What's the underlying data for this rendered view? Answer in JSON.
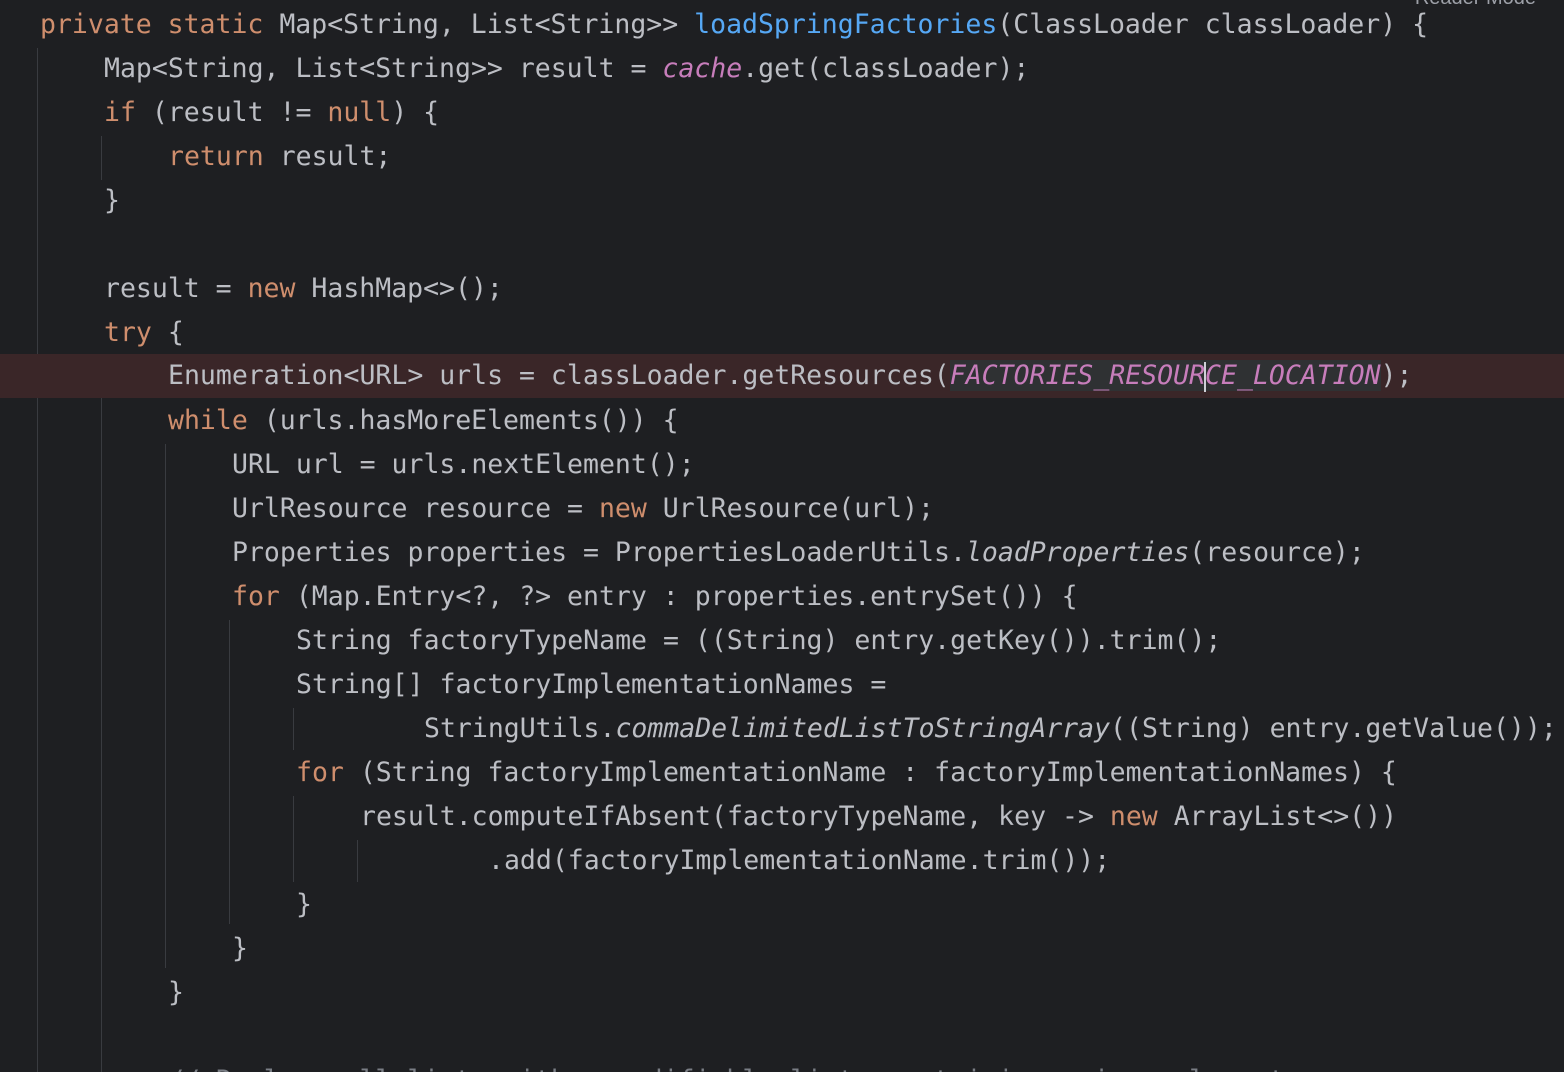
{
  "editor": {
    "reader_mode_label": "Reader Mode",
    "colors": {
      "background": "#1e1f22",
      "keyword": "#cf8e6d",
      "method_declaration": "#56a8f5",
      "static_field": "#c77dbb",
      "default_text": "#bcbec4",
      "current_line": "#3a2628"
    },
    "lines": {
      "l1": {
        "kw": "private static",
        "pre": " Map<String, List<String>> ",
        "fn": "loadSpringFactories",
        "post": "(ClassLoader classLoader) {"
      },
      "l2": {
        "pre": "Map<String, List<String>> result = ",
        "field": "cache",
        "post": ".get(classLoader);"
      },
      "l3": {
        "kw1": "if",
        "mid": " (result != ",
        "kw2": "null",
        "post": ") {"
      },
      "l4": {
        "kw": "return",
        "post": " result;"
      },
      "l5": {
        "text": "}"
      },
      "l6": {
        "pre": "result = ",
        "kw": "new",
        "post": " HashMap<>();"
      },
      "l7": {
        "kw": "try",
        "post": " {"
      },
      "l8": {
        "pre": "Enumeration<URL> urls = classLoader.getResources(",
        "const_a": "FACTORIES_RESOUR",
        "const_b": "CE_LOCATION",
        "post": ");"
      },
      "l9": {
        "kw": "while",
        "post": " (urls.hasMoreElements()) {"
      },
      "l10": {
        "text": "URL url = urls.nextElement();"
      },
      "l11": {
        "pre": "UrlResource resource = ",
        "kw": "new",
        "post": " UrlResource(url);"
      },
      "l12": {
        "pre": "Properties properties = PropertiesLoaderUtils.",
        "call": "loadProperties",
        "post": "(resource);"
      },
      "l13": {
        "kw": "for",
        "post": " (Map.Entry<?, ?> entry : properties.entrySet()) {"
      },
      "l14": {
        "text": "String factoryTypeName = ((String) entry.getKey()).trim();"
      },
      "l15": {
        "text": "String[] factoryImplementationNames ="
      },
      "l16": {
        "pre": "StringUtils.",
        "call": "commaDelimitedListToStringArray",
        "post": "((String) entry.getValue());"
      },
      "l17": {
        "kw": "for",
        "post": " (String factoryImplementationName : factoryImplementationNames) {"
      },
      "l18": {
        "pre": "result.computeIfAbsent(factoryTypeName, key -> ",
        "kw": "new",
        "post": " ArrayList<>())"
      },
      "l19": {
        "text": ".add(factoryImplementationName.trim());"
      },
      "l20": {
        "text": "}"
      },
      "l21": {
        "text": "}"
      },
      "l22": {
        "text": "}"
      },
      "l23": {
        "comment": "// Replace all lists with unmodifiable lists containing unique elements"
      }
    }
  }
}
